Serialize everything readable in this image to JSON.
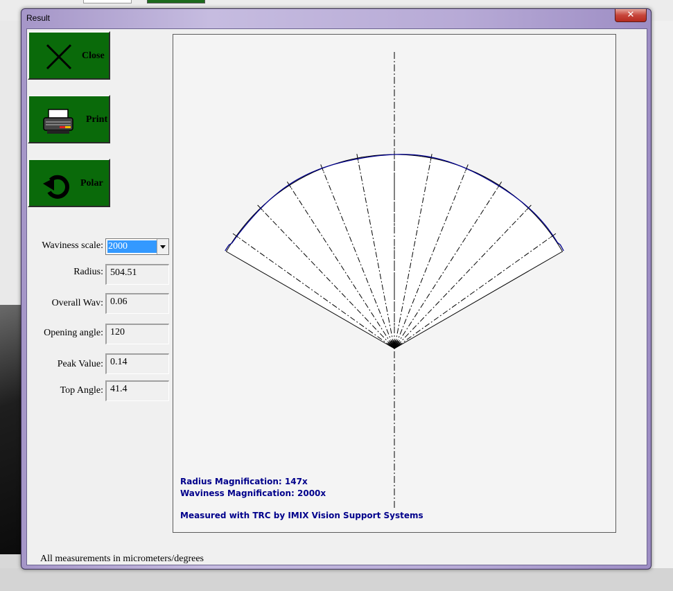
{
  "window": {
    "title": "Result",
    "close_glyph": "✕"
  },
  "buttons": {
    "close": {
      "label": "Close",
      "icon": "close-x-icon"
    },
    "print": {
      "label": "Print",
      "icon": "printer-icon"
    },
    "polar": {
      "label": "Polar",
      "icon": "rotate-icon"
    }
  },
  "fields": {
    "waviness_scale": {
      "label": "Waviness scale:",
      "value": "2000"
    },
    "radius": {
      "label": "Radius:",
      "value": "504.51"
    },
    "overall_wav": {
      "label": "Overall Wav:",
      "value": "0.06"
    },
    "opening_angle": {
      "label": "Opening angle:",
      "value": "120"
    },
    "peak_value": {
      "label": "Peak Value:",
      "value": "0.14"
    },
    "top_angle": {
      "label": "Top Angle:",
      "value": "41.4"
    }
  },
  "footer": "All measurements in micrometers/degrees",
  "plot": {
    "radius_mag": "Radius Magnification: 147x",
    "waviness_mag": "Waviness Magnification: 2000x",
    "credit": "Measured with TRC by IMIX Vision Support Systems",
    "opening_angle_deg": 120,
    "radial_lines": 11,
    "colors": {
      "profile": "#00008b",
      "lines": "#000000",
      "background": "#f4f4f4"
    }
  }
}
